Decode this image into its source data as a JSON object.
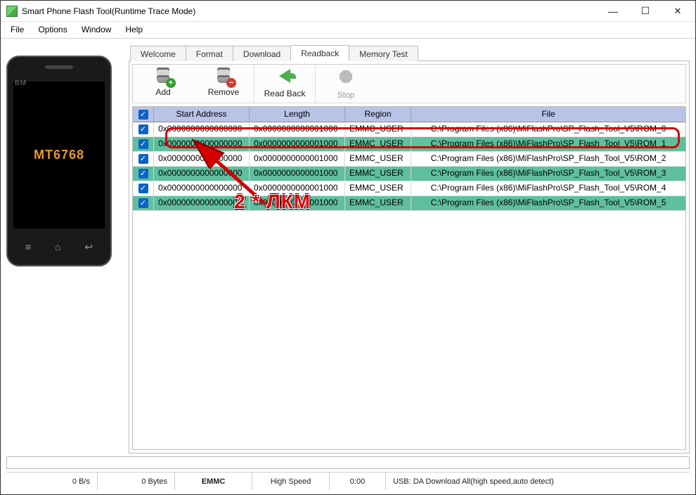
{
  "window": {
    "title": "Smart Phone Flash Tool(Runtime Trace Mode)"
  },
  "menu": [
    "File",
    "Options",
    "Window",
    "Help"
  ],
  "phone": {
    "brand": "BM",
    "chip": "MT6768"
  },
  "tabs": [
    "Welcome",
    "Format",
    "Download",
    "Readback",
    "Memory Test"
  ],
  "active_tab": "Readback",
  "toolbar": {
    "add": "Add",
    "remove": "Remove",
    "readback": "Read Back",
    "stop": "Stop"
  },
  "table": {
    "headers": {
      "start": "Start Address",
      "length": "Length",
      "region": "Region",
      "file": "File"
    },
    "rows": [
      {
        "checked": true,
        "addr": "0x0000000000000000",
        "len": "0x0000000000001000",
        "region": "EMMC_USER",
        "file": "C:\\Program Files (x86)\\MiFlashPro\\SP_Flash_Tool_V5\\ROM_0"
      },
      {
        "checked": true,
        "addr": "0x0000000000000000",
        "len": "0x0000000000001000",
        "region": "EMMC_USER",
        "file": "C:\\Program Files (x86)\\MiFlashPro\\SP_Flash_Tool_V5\\ROM_1"
      },
      {
        "checked": true,
        "addr": "0x0000000000000000",
        "len": "0x0000000000001000",
        "region": "EMMC_USER",
        "file": "C:\\Program Files (x86)\\MiFlashPro\\SP_Flash_Tool_V5\\ROM_2"
      },
      {
        "checked": true,
        "addr": "0x0000000000000000",
        "len": "0x0000000000001000",
        "region": "EMMC_USER",
        "file": "C:\\Program Files (x86)\\MiFlashPro\\SP_Flash_Tool_V5\\ROM_3"
      },
      {
        "checked": true,
        "addr": "0x0000000000000000",
        "len": "0x0000000000001000",
        "region": "EMMC_USER",
        "file": "C:\\Program Files (x86)\\MiFlashPro\\SP_Flash_Tool_V5\\ROM_4"
      },
      {
        "checked": true,
        "addr": "0x0000000000000000",
        "len": "0x0000000000001000",
        "region": "EMMC_USER",
        "file": "C:\\Program Files (x86)\\MiFlashPro\\SP_Flash_Tool_V5\\ROM_5"
      }
    ]
  },
  "annotation": {
    "label": "2 * ЛКМ"
  },
  "status": {
    "speed": "0 B/s",
    "bytes": "0 Bytes",
    "storage": "EMMC",
    "mode": "High Speed",
    "time": "0:00",
    "usb": "USB: DA Download All(high speed,auto detect)"
  }
}
